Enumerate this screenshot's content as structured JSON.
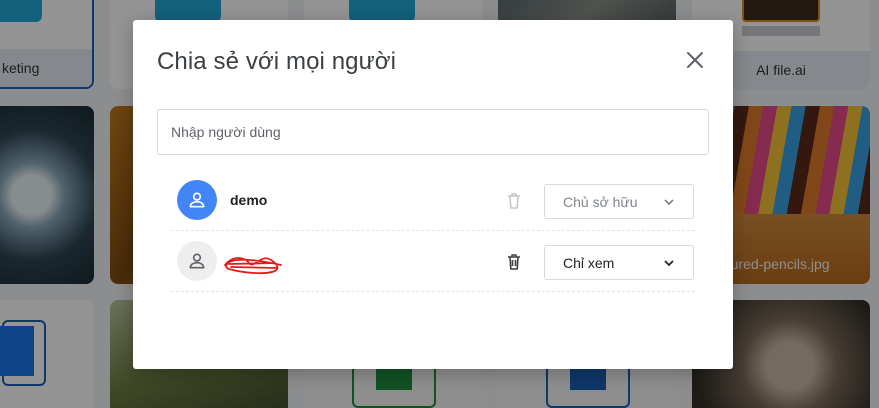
{
  "background": {
    "captions": [
      "keting",
      "AI file.ai",
      "oloured-pencils.jpg"
    ]
  },
  "dialog": {
    "title": "Chia sẻ với mọi người",
    "close_icon": "close-icon",
    "search": {
      "placeholder": "Nhập người dùng",
      "value": ""
    },
    "users": [
      {
        "name": "demo",
        "role": "Chủ sở hữu",
        "role_editable": false,
        "avatar_color": "#4285f4"
      },
      {
        "name": "",
        "name_redacted": true,
        "role": "Chỉ xem",
        "role_editable": true,
        "avatar_color": "#eeeeee"
      }
    ]
  }
}
